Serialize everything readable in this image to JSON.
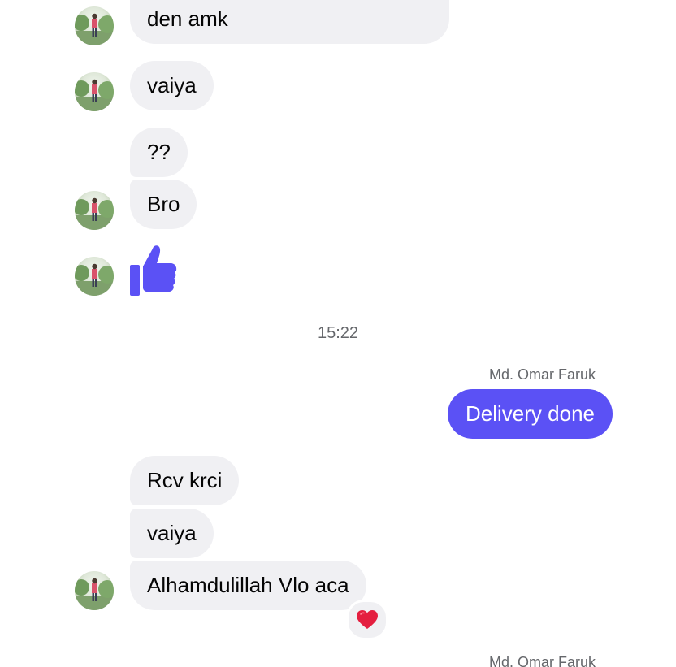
{
  "messages": {
    "m1": "den amk",
    "m2": "vaiya",
    "m3": "??",
    "m4": "Bro",
    "m5": "Rcv krci",
    "m6": "vaiya",
    "m7": "Alhamdulillah Vlo aca"
  },
  "like_icon": "thumbs-up-icon",
  "like_color": "#5b51f5",
  "timestamp": "15:22",
  "outgoing": {
    "sender_name": "Md. Omar Faruk",
    "text": "Delivery done",
    "bubble_color": "#5b51f5"
  },
  "reaction": {
    "icon": "heart-icon",
    "color": "#e41e3f"
  },
  "next_sender_name": "Md. Omar Faruk"
}
